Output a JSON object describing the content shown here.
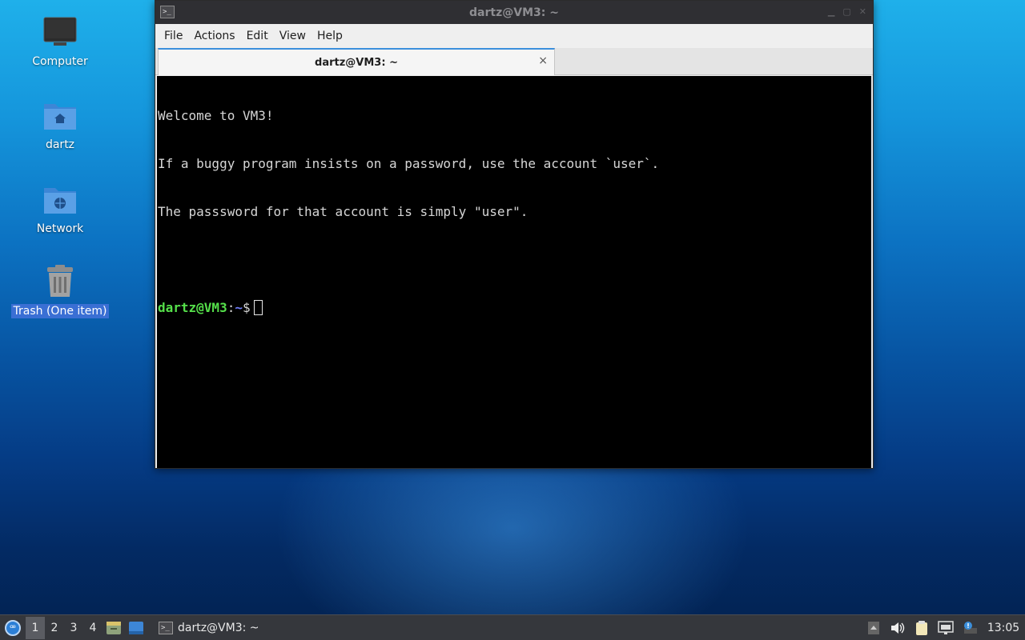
{
  "desktop": {
    "icons": [
      {
        "label": "Computer",
        "icon": "computer-icon"
      },
      {
        "label": "dartz",
        "icon": "home-folder-icon"
      },
      {
        "label": "Network",
        "icon": "network-folder-icon"
      },
      {
        "label": "Trash (One item)",
        "icon": "trash-icon"
      }
    ]
  },
  "window": {
    "title": "dartz@VM3: ~",
    "menu": [
      "File",
      "Actions",
      "Edit",
      "View",
      "Help"
    ],
    "tab": {
      "title": "dartz@VM3: ~",
      "close": "×"
    },
    "terminal": {
      "lines": [
        "Welcome to VM3!",
        "If a buggy program insists on a password, use the account `user`.",
        "The passsword for that account is simply \"user\"."
      ],
      "prompt_user": "dartz@VM3",
      "prompt_sep": ":",
      "prompt_path": "~",
      "prompt_symbol": "$"
    }
  },
  "taskbar": {
    "workspaces": [
      "1",
      "2",
      "3",
      "4"
    ],
    "active_workspace": "1",
    "task_title": "dartz@VM3: ~",
    "clock": "13:05"
  },
  "colors": {
    "prompt_user": "#55e04a",
    "prompt_path": "#6f7cf7",
    "tab_accent": "#3b8fdc",
    "selection": "#3a6fd4"
  }
}
